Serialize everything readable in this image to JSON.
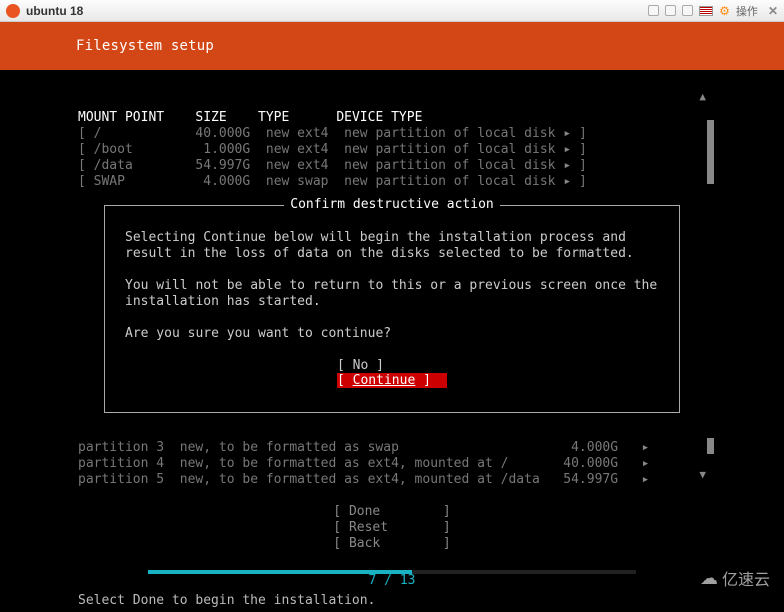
{
  "window": {
    "title": "ubuntu 18",
    "op_label": "操作"
  },
  "header": {
    "title": "Filesystem setup"
  },
  "table": {
    "headers": {
      "mount": "MOUNT POINT",
      "size": "SIZE",
      "type": "TYPE",
      "device": "DEVICE TYPE"
    },
    "rows": [
      {
        "mount": "/",
        "size": "40.000G",
        "type": "new ext4",
        "device": "new partition of local disk"
      },
      {
        "mount": "/boot",
        "size": "1.000G",
        "type": "new ext4",
        "device": "new partition of local disk"
      },
      {
        "mount": "/data",
        "size": "54.997G",
        "type": "new ext4",
        "device": "new partition of local disk"
      },
      {
        "mount": "SWAP",
        "size": "4.000G",
        "type": "new swap",
        "device": "new partition of local disk"
      }
    ]
  },
  "dialog": {
    "title": "Confirm destructive action",
    "p1": "Selecting Continue below will begin the installation process and result in the loss of data on the disks selected to be formatted.",
    "p2": "You will not be able to return to this or a previous screen once the installation has started.",
    "p3": "Are you sure you want to continue?",
    "no": "No",
    "continue": "Continue"
  },
  "partitions": [
    {
      "name": "partition 3",
      "desc": "new, to be formatted as swap",
      "size": "4.000G"
    },
    {
      "name": "partition 4",
      "desc": "new, to be formatted as ext4, mounted at /",
      "size": "40.000G"
    },
    {
      "name": "partition 5",
      "desc": "new, to be formatted as ext4, mounted at /data",
      "size": "54.997G"
    }
  ],
  "actions": {
    "done": "Done",
    "reset": "Reset",
    "back": "Back"
  },
  "progress": {
    "current": 7,
    "total": 13,
    "text": "7 / 13"
  },
  "hint": "Select Done to begin the installation.",
  "watermark": "亿速云"
}
